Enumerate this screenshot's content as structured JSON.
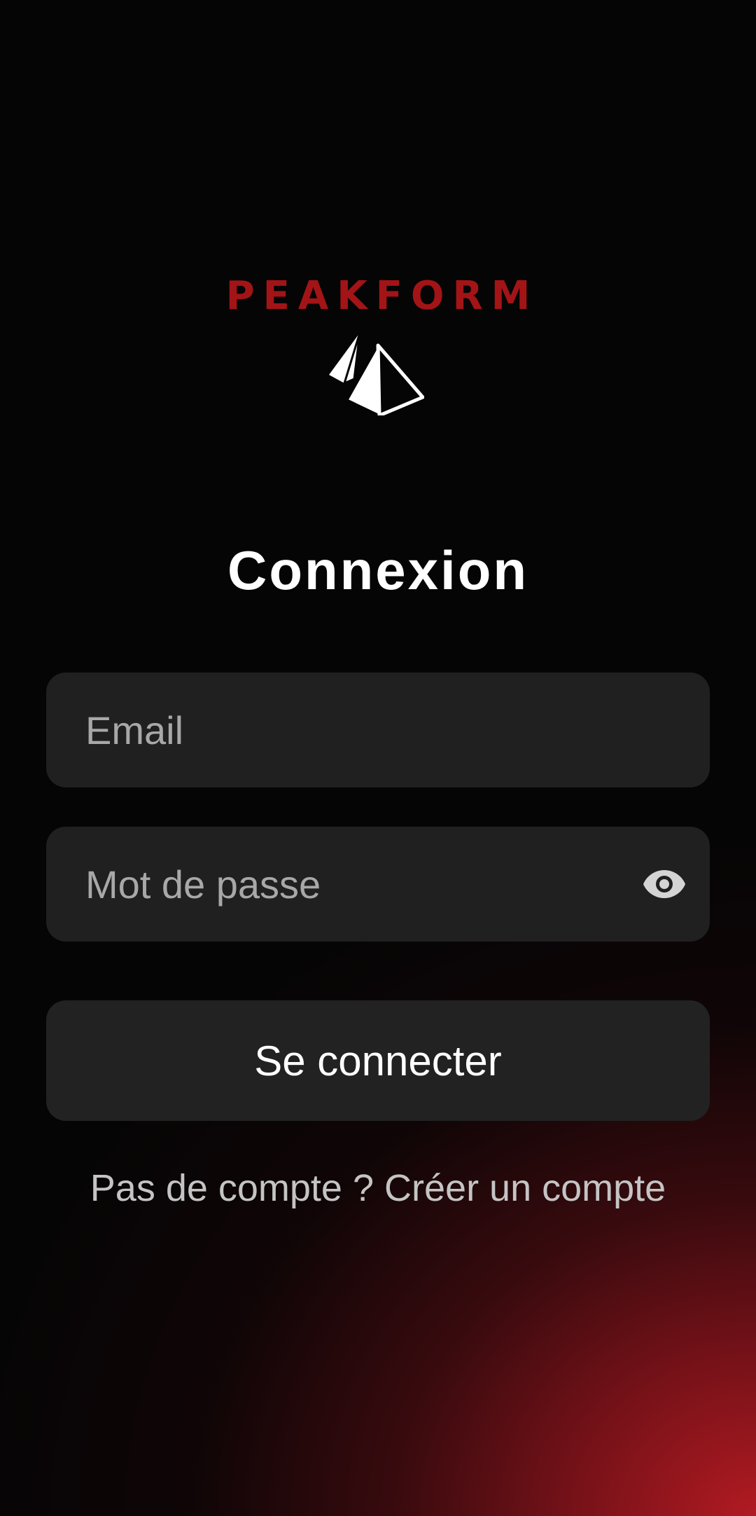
{
  "brand": {
    "name": "PEAKFORM",
    "color": "#a31417",
    "mark_icon": "twin-pyramids-icon"
  },
  "screen": {
    "title": "Connexion",
    "background_accent": "#b21a22"
  },
  "form": {
    "email": {
      "placeholder": "Email",
      "value": ""
    },
    "password": {
      "placeholder": "Mot de passe",
      "value": "",
      "toggle_icon": "eye-icon"
    },
    "submit_label": "Se connecter"
  },
  "signup": {
    "prompt": "Pas de compte ?",
    "link_label": "Créer un compte"
  }
}
